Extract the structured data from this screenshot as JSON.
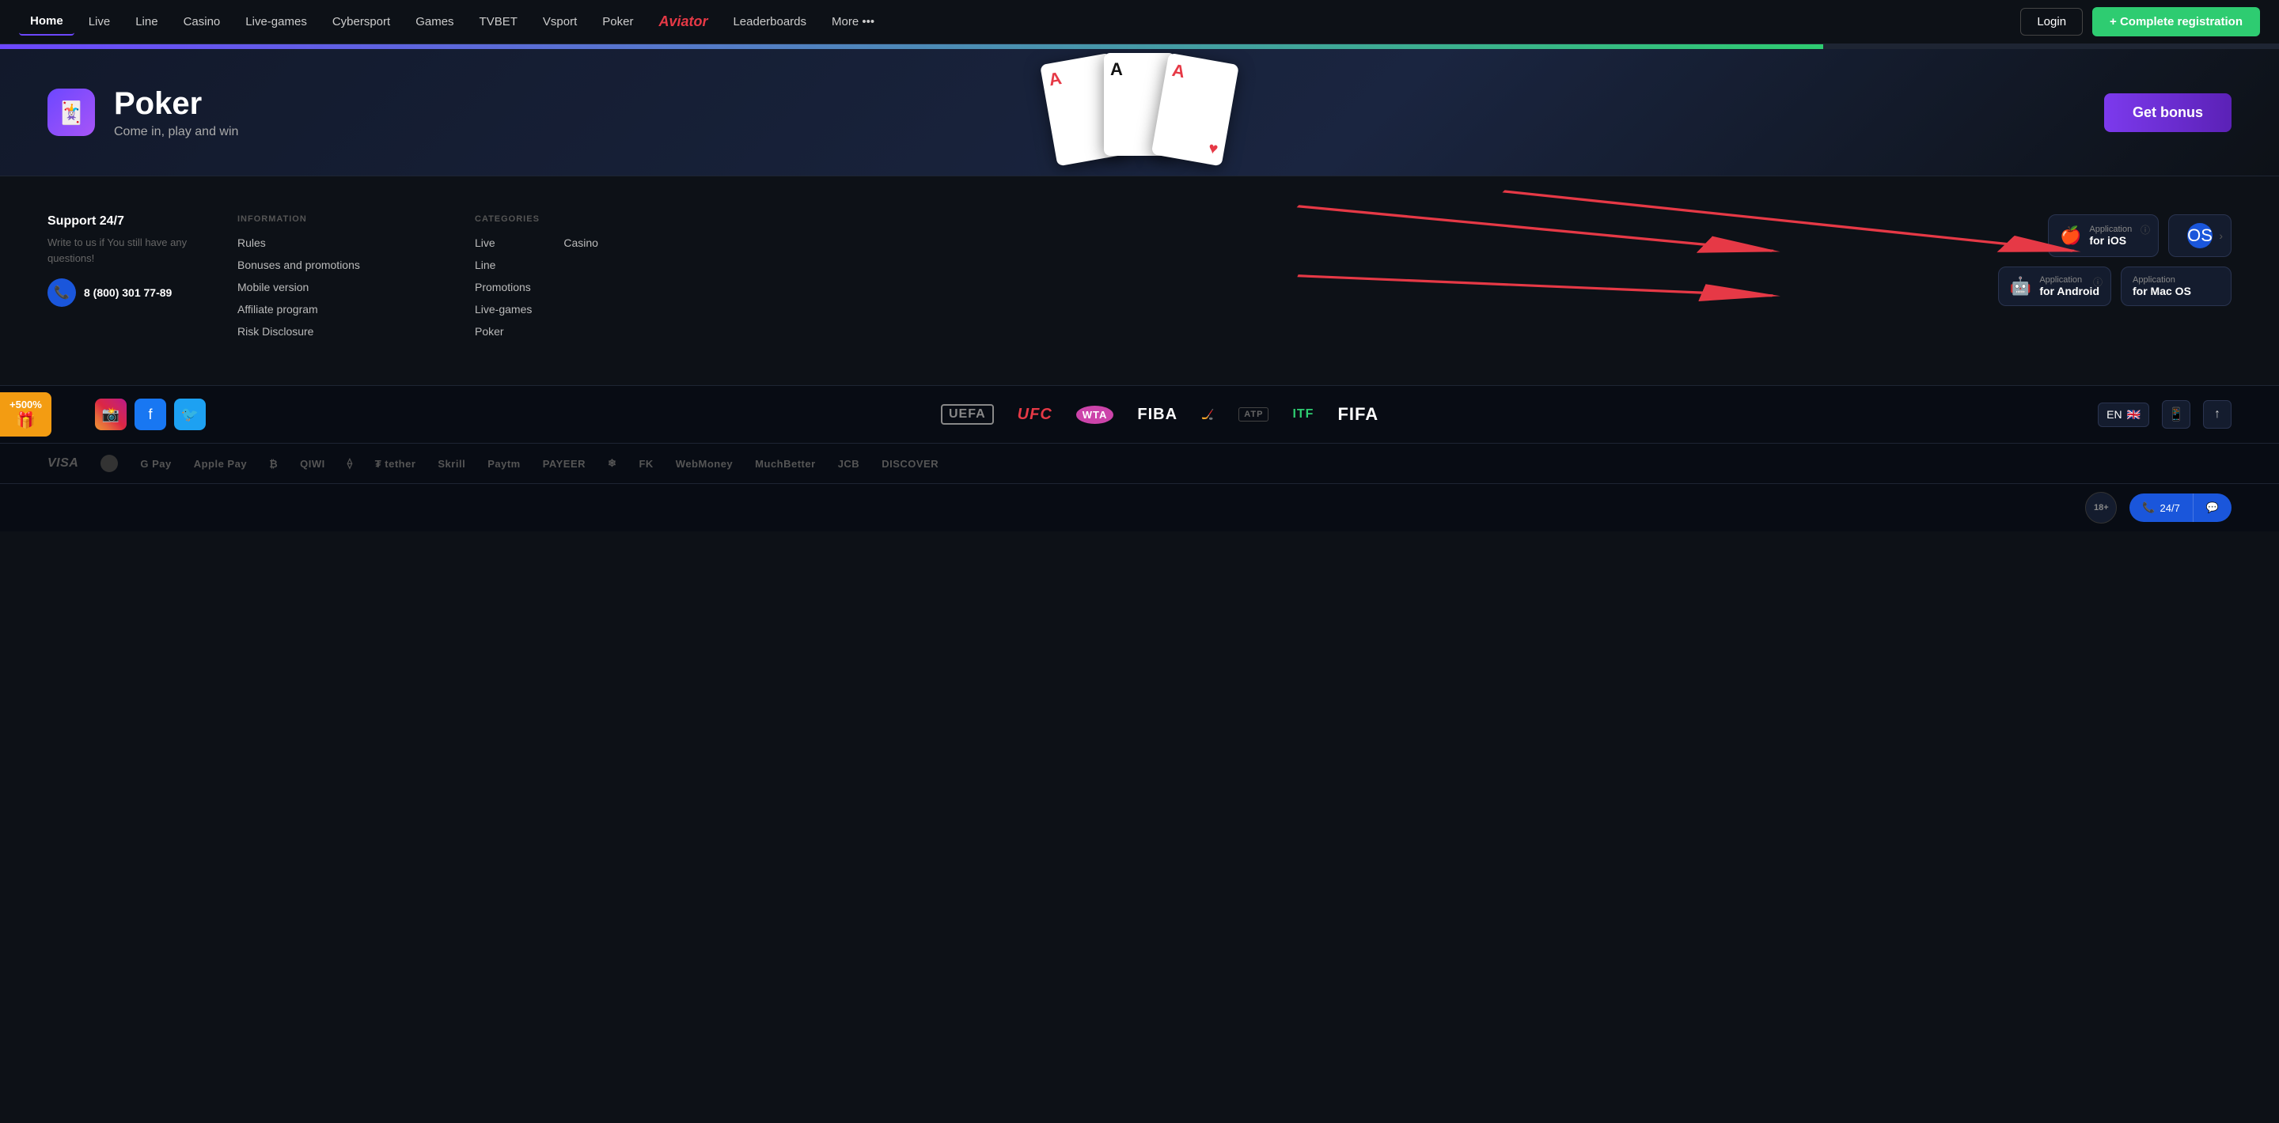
{
  "nav": {
    "links": [
      {
        "label": "Home",
        "active": true
      },
      {
        "label": "Live",
        "active": false
      },
      {
        "label": "Line",
        "active": false
      },
      {
        "label": "Casino",
        "active": false
      },
      {
        "label": "Live-games",
        "active": false
      },
      {
        "label": "Cybersport",
        "active": false
      },
      {
        "label": "Games",
        "active": false
      },
      {
        "label": "TVBET",
        "active": false
      },
      {
        "label": "Vsport",
        "active": false
      },
      {
        "label": "Poker",
        "active": false
      },
      {
        "label": "Aviator",
        "active": false,
        "special": "aviator"
      },
      {
        "label": "Leaderboards",
        "active": false
      },
      {
        "label": "More •••",
        "active": false
      }
    ],
    "login_label": "Login",
    "register_label": "+ Complete registration"
  },
  "poker_banner": {
    "title": "Poker",
    "subtitle": "Come in, play and win",
    "get_bonus": "Get bonus"
  },
  "footer": {
    "support_title": "Support 24/7",
    "support_text": "Write to us if You still have any questions!",
    "phone": "8 (800) 301 77-89",
    "info_heading": "INFORMATION",
    "info_links": [
      "Rules",
      "Bonuses and promotions",
      "Mobile version",
      "Affiliate program",
      "Risk Disclosure"
    ],
    "categories_heading": "CATEGORIES",
    "categories_col1": [
      "Live",
      "Line",
      "Promotions",
      "Live-games",
      "Poker"
    ],
    "categories_col2": [
      "Casino"
    ],
    "apps": {
      "ios_label": "Application",
      "ios_platform": "for iOS",
      "android_label": "Application",
      "android_platform": "for Android",
      "macos_label": "Application",
      "macos_platform": "for Mac OS"
    }
  },
  "sponsors": [
    "UEFA",
    "UFC",
    "WTA",
    "FIBA",
    "NHL",
    "ATP",
    "ITF",
    "FIFA"
  ],
  "social": [
    "Instagram",
    "Facebook",
    "Twitter"
  ],
  "lang": "EN",
  "payments": [
    "VISA",
    "Mastercard",
    "G Pay",
    "Apple Pay",
    "Bitcoin",
    "QIWI",
    "Ethereum",
    "Tether",
    "Skrill",
    "Paytm",
    "PAYEER",
    "FK",
    "WebMoney",
    "MuchBetter",
    "JCB",
    "DISCOVER"
  ],
  "bonus_badge": "+500%",
  "age_rating": "18+",
  "chat_label": "24/7"
}
